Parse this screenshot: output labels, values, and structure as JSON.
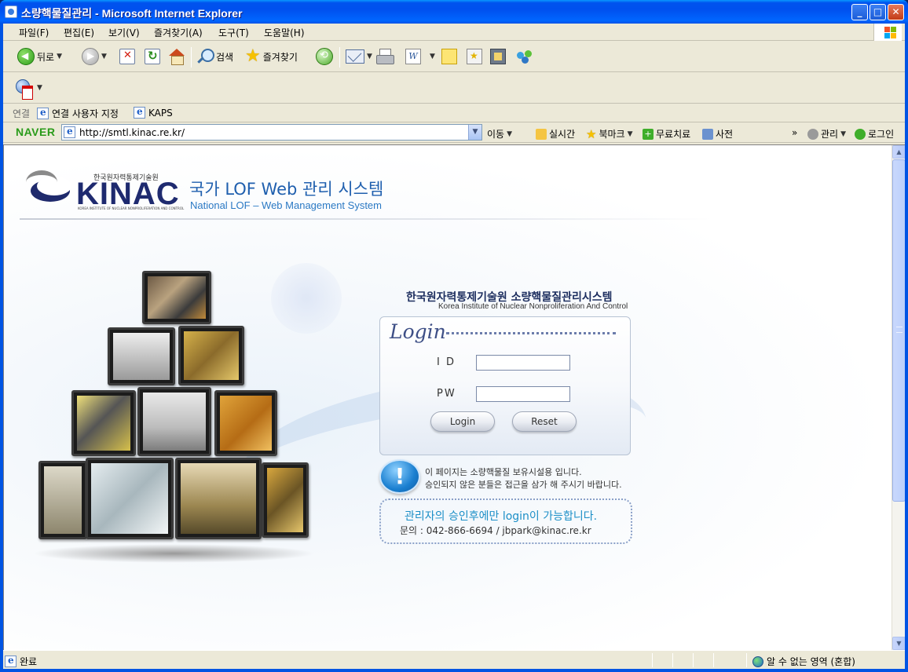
{
  "window": {
    "title": "소량핵물질관리 - Microsoft Internet Explorer",
    "buttons": {
      "minimize": "_",
      "maximize": "□",
      "close": "✕"
    }
  },
  "menu": [
    "파일(F)",
    "편집(E)",
    "보기(V)",
    "즐겨찾기(A)",
    "도구(T)",
    "도움말(H)"
  ],
  "toolbar": {
    "back": "뒤로",
    "search": "검색",
    "favorites": "즐겨찾기"
  },
  "links": {
    "label": "연결",
    "items": [
      "연결 사용자 지정",
      "KAPS"
    ]
  },
  "address": {
    "brand": "NAVER",
    "url": "http://smtl.kinac.re.kr/",
    "go": "이동",
    "items": [
      "실시간",
      "북마크",
      "무료치료",
      "사전"
    ],
    "right": [
      "관리",
      "로그인"
    ]
  },
  "page": {
    "logo_kr": "한국원자력통제기술원",
    "logo_word": "KINAC",
    "logo_sub": "KOREA INSTITUTE OF NUCLEAR NONPROLIFERATION AND CONTROL",
    "system_title": "국가 LOF Web 관리 시스템",
    "system_subtitle": "National LOF – Web Management System",
    "org_kr": "한국원자력통제기술원 소량핵물질관리시스템",
    "org_en": "Korea Institute of Nuclear Nonproliferation And Control",
    "login": {
      "heading": "Login",
      "id_label": "I D",
      "pw_label": "PW",
      "id_value": "",
      "pw_value": "",
      "login_button": "Login",
      "reset_button": "Reset"
    },
    "notice_line1": "이 페이지는 소량핵물질 보유시설용 입니다.",
    "notice_line2": "승인되지 않은 분들은 접근을 삼가 해 주시기 바랍니다.",
    "approval": "관리자의 승인후에만 login이 가능합니다.",
    "contact": "문의 : 042-866-6694  /  jbpark@kinac.re.kr"
  },
  "status": {
    "text": "완료",
    "zone": "알 수 없는 영역 (혼합)"
  }
}
